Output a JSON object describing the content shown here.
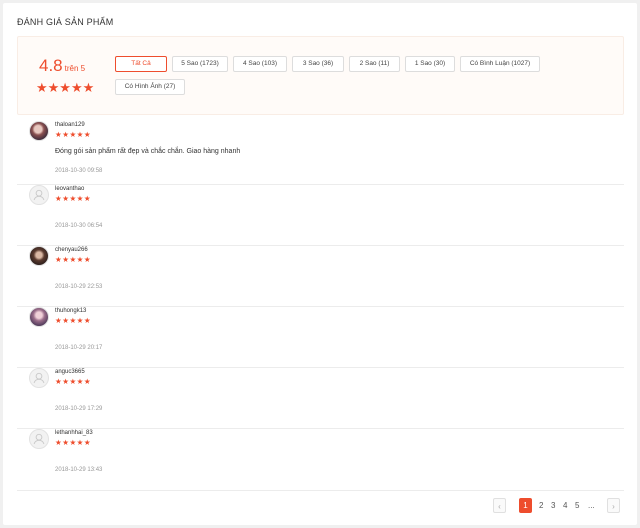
{
  "section": {
    "title": "ĐÁNH GIÁ SẢN PHẨM"
  },
  "summary": {
    "score": "4.8",
    "score_suffix": "trên 5",
    "stars": "★★★★★"
  },
  "filters": [
    {
      "label": "Tất Cả",
      "active": true
    },
    {
      "label": "5 Sao (1723)"
    },
    {
      "label": "4 Sao (103)"
    },
    {
      "label": "3 Sao (36)"
    },
    {
      "label": "2 Sao (11)"
    },
    {
      "label": "1 Sao (30)"
    },
    {
      "label": "Có Bình Luận (1027)"
    },
    {
      "label": "Có Hình Ảnh (27)"
    }
  ],
  "reviews": [
    {
      "username": "thaloan129",
      "stars": "★★★★★",
      "comment": "Đóng gói sản phẩm rất đẹp và chắc chắn. Giao hàng nhanh",
      "time": "2018-10-30 09:58",
      "avatar": "photo1"
    },
    {
      "username": "leovanthao",
      "stars": "★★★★★",
      "comment": "",
      "time": "2018-10-30 06:54",
      "avatar": "default"
    },
    {
      "username": "chenyau266",
      "stars": "★★★★★",
      "comment": "",
      "time": "2018-10-29 22:53",
      "avatar": "photo2"
    },
    {
      "username": "thuhongk13",
      "stars": "★★★★★",
      "comment": "",
      "time": "2018-10-29 20:17",
      "avatar": "photo3"
    },
    {
      "username": "anguc3665",
      "stars": "★★★★★",
      "comment": "",
      "time": "2018-10-29 17:29",
      "avatar": "default"
    },
    {
      "username": "lethanhhai_83",
      "stars": "★★★★★",
      "comment": "",
      "time": "2018-10-29 13:43",
      "avatar": "default"
    }
  ],
  "pagination": {
    "prev": "‹",
    "pages": [
      "1",
      "2",
      "3",
      "4",
      "5",
      "..."
    ],
    "next": "›",
    "current": "1"
  }
}
